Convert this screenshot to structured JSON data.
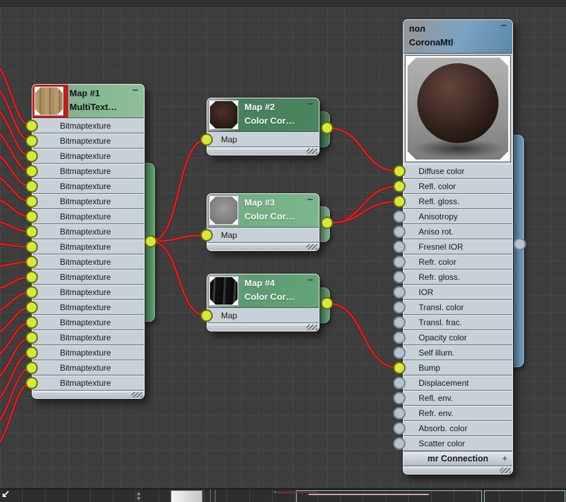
{
  "window": {
    "background": "#3d3d3d",
    "grid_color": "#474747"
  },
  "colors": {
    "wire": "#d62b2b",
    "wire_outline": "#7d1616",
    "socket_connected": "#d9e73b",
    "socket_empty": "#b6c2cd",
    "map_node_accent": "#5ea36f",
    "material_node_accent": "#6f9cbf",
    "selection_red": "#bf1f1f"
  },
  "nodes": {
    "map1": {
      "title": "Map #1",
      "subtitle": "MultiText…",
      "minimize_label": "−",
      "thumbnail": "wood-texture",
      "slots": [
        {
          "label": "Bitmaptexture",
          "connected": true
        },
        {
          "label": "Bitmaptexture",
          "connected": true
        },
        {
          "label": "Bitmaptexture",
          "connected": true
        },
        {
          "label": "Bitmaptexture",
          "connected": true
        },
        {
          "label": "Bitmaptexture",
          "connected": true
        },
        {
          "label": "Bitmaptexture",
          "connected": true
        },
        {
          "label": "Bitmaptexture",
          "connected": true
        },
        {
          "label": "Bitmaptexture",
          "connected": true
        },
        {
          "label": "Bitmaptexture",
          "connected": true
        },
        {
          "label": "Bitmaptexture",
          "connected": true
        },
        {
          "label": "Bitmaptexture",
          "connected": true
        },
        {
          "label": "Bitmaptexture",
          "connected": true
        },
        {
          "label": "Bitmaptexture",
          "connected": true
        },
        {
          "label": "Bitmaptexture",
          "connected": true
        },
        {
          "label": "Bitmaptexture",
          "connected": true
        },
        {
          "label": "Bitmaptexture",
          "connected": true
        },
        {
          "label": "Bitmaptexture",
          "connected": true
        },
        {
          "label": "Bitmaptexture",
          "connected": true
        }
      ]
    },
    "map2": {
      "title": "Map #2",
      "subtitle": "Color Cor…",
      "minimize_label": "−",
      "thumbnail": "dark-brown-texture",
      "slots": [
        {
          "label": "Map",
          "connected": true
        }
      ]
    },
    "map3": {
      "title": "Map #3",
      "subtitle": "Color Cor…",
      "minimize_label": "−",
      "thumbnail": "gray-texture",
      "slots": [
        {
          "label": "Map",
          "connected": true
        }
      ]
    },
    "map4": {
      "title": "Map #4",
      "subtitle": "Color Cor…",
      "minimize_label": "−",
      "thumbnail": "dark-streaks-texture",
      "slots": [
        {
          "label": "Map",
          "connected": true
        }
      ]
    },
    "corona": {
      "title": "пол",
      "subtitle": "CoronaMtl",
      "minimize_label": "−",
      "preview": "material-sphere",
      "slots": [
        {
          "label": "Diffuse color",
          "connected": true
        },
        {
          "label": "Refl. color",
          "connected": true
        },
        {
          "label": "Refl. gloss.",
          "connected": true
        },
        {
          "label": "Anisotropy",
          "connected": false
        },
        {
          "label": "Aniso rot.",
          "connected": false
        },
        {
          "label": "Fresnel IOR",
          "connected": false
        },
        {
          "label": "Refr. color",
          "connected": false
        },
        {
          "label": "Refr. gloss.",
          "connected": false
        },
        {
          "label": "IOR",
          "connected": false
        },
        {
          "label": "Transl. color",
          "connected": false
        },
        {
          "label": "Transl. frac.",
          "connected": false
        },
        {
          "label": "Opacity color",
          "connected": false
        },
        {
          "label": "Self illum.",
          "connected": false
        },
        {
          "label": "Bump",
          "connected": true
        },
        {
          "label": "Displacement",
          "connected": false
        },
        {
          "label": "Refl. env.",
          "connected": false
        },
        {
          "label": "Refr. env.",
          "connected": false
        },
        {
          "label": "Absorb. color",
          "connected": false
        },
        {
          "label": "Scatter color",
          "connected": false
        }
      ],
      "rollout": {
        "label": "mr Connection",
        "expand_label": "+"
      }
    }
  },
  "connections": {
    "left_edge_entries": [
      83,
      117,
      150,
      184,
      218,
      252,
      286,
      320,
      354,
      388,
      422,
      456,
      490,
      524,
      558,
      592,
      626,
      660
    ],
    "links": [
      {
        "from": "out-map1",
        "to": "in-map2-0"
      },
      {
        "from": "out-map1",
        "to": "in-map3-0"
      },
      {
        "from": "out-map1",
        "to": "in-map4-0"
      },
      {
        "from": "out-map2",
        "to": "in-corona-0"
      },
      {
        "from": "out-map3",
        "to": "in-corona-1"
      },
      {
        "from": "out-map3",
        "to": "in-corona-2"
      },
      {
        "from": "out-map4",
        "to": "in-corona-13"
      }
    ]
  }
}
